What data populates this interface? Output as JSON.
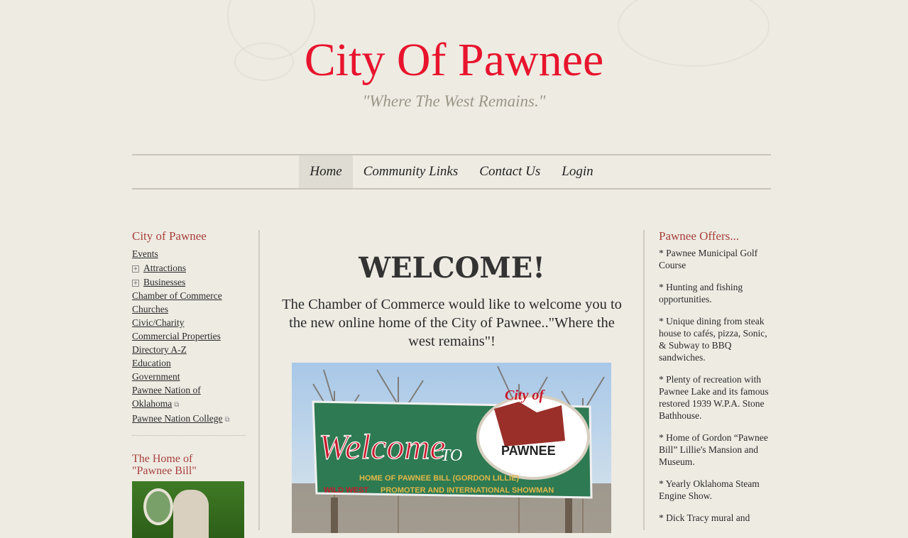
{
  "site": {
    "title": "City Of Pawnee",
    "tagline": "\"Where The West Remains.\""
  },
  "nav": {
    "items": [
      "Home",
      "Community Links",
      "Contact Us",
      "Login"
    ],
    "active": "Home"
  },
  "sidebar": {
    "heading": "City of Pawnee",
    "events": "Events",
    "attractions": "Attractions",
    "businesses": "Businesses",
    "chamber": "Chamber of Commerce",
    "churches": "Churches",
    "civic": "Civic/Charity",
    "commercial": "Commercial Properties",
    "directory": "Directory A-Z",
    "education": "Education",
    "government": "Government",
    "nation_line1": "Pawnee Nation of",
    "nation_line2": "Oklahoma",
    "college": "Pawnee Nation College",
    "bill_line1": "The Home of",
    "bill_line2": "\"Pawnee Bill\""
  },
  "main": {
    "welcome": "WELCOME!",
    "intro": "The Chamber of Commerce would like to welcome you to the new online home of the City of Pawnee..\"Where the west remains\"!"
  },
  "sign": {
    "welcome": "Welcome",
    "to": "TO",
    "city_of": "City of",
    "pawnee": "PAWNEE",
    "home_line": "HOME OF PAWNEE BILL (GORDON LILLIE)",
    "wild_west": "WILD WEST",
    "promoter": "PROMOTER AND INTERNATIONAL SHOWMAN"
  },
  "offers": {
    "heading": "Pawnee Offers...",
    "items": [
      "* Pawnee Municipal Golf Course",
      "* Hunting and fishing opportunities.",
      "* Unique dining from steak house to cafés, pizza, Sonic, & Subway to BBQ sandwiches.",
      "* Plenty of recreation with Pawnee Lake and its famous restored 1939 W.P.A. Stone Bathhouse.",
      "* Home of Gordon “Pawnee Bill” Lillie's Mansion and Museum.",
      "* Yearly Oklahoma Steam Engine Show.",
      "* Dick Tracy mural and"
    ]
  },
  "colors": {
    "title": "#e8142d",
    "heading": "#a8403c",
    "tagline": "#9a9686",
    "background": "#eeebe3",
    "nav_active": "#dfdcd3"
  }
}
